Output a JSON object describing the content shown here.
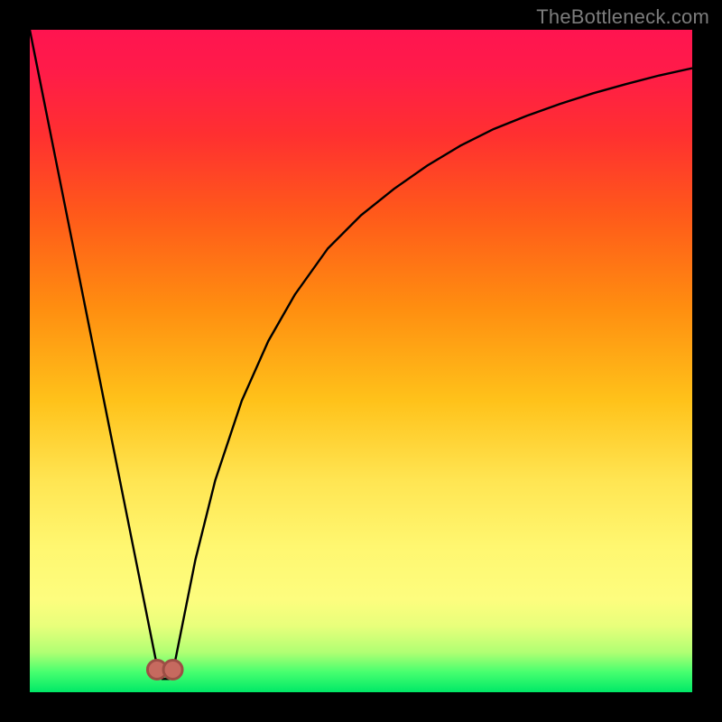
{
  "watermark": "TheBottleneck.com",
  "colors": {
    "frame": "#000000",
    "curve": "#000000",
    "marker_fill": "#c66a5f",
    "marker_stroke": "#9c4e45",
    "gradient_stops": [
      "#ff1450",
      "#ff1b49",
      "#ff3030",
      "#ff5a1a",
      "#ff8e10",
      "#ffc21a",
      "#ffe552",
      "#fff770",
      "#fdfd7e",
      "#e8ff7b",
      "#b0ff73",
      "#46ff6f",
      "#00e867"
    ]
  },
  "chart_data": {
    "type": "line",
    "title": "",
    "xlabel": "",
    "ylabel": "",
    "xlim": [
      0,
      100
    ],
    "ylim": [
      0,
      100
    ],
    "series": [
      {
        "name": "bottleneck-curve",
        "x": [
          0,
          2,
          4,
          6,
          8,
          10,
          12,
          14,
          16,
          18,
          19,
          20,
          21,
          22,
          23,
          25,
          28,
          32,
          36,
          40,
          45,
          50,
          55,
          60,
          65,
          70,
          75,
          80,
          85,
          90,
          95,
          100
        ],
        "y": [
          100,
          90,
          80,
          70,
          60,
          50,
          40,
          30,
          20,
          10,
          5,
          2,
          2,
          5,
          10,
          20,
          32,
          44,
          53,
          60,
          67,
          72,
          76,
          79.5,
          82.5,
          85,
          87,
          88.8,
          90.4,
          91.8,
          93.1,
          94.2
        ]
      }
    ],
    "markers": [
      {
        "name": "optimal-left",
        "x": 19.2,
        "y": 3.4
      },
      {
        "name": "optimal-right",
        "x": 21.6,
        "y": 3.4
      }
    ],
    "annotations": []
  }
}
